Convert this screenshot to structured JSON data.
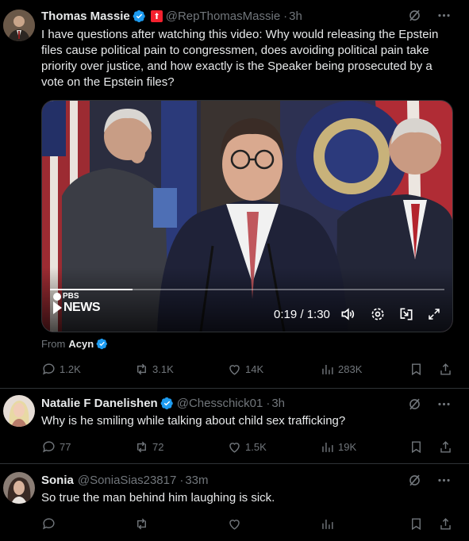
{
  "posts": [
    {
      "name": "Thomas Massie",
      "handle": "@RepThomasMassie",
      "time": "3h",
      "text": "I have questions after watching this video: Why would releasing the Epstein files cause political pain to congressmen, does avoiding political pain take priority over justice, and how exactly is the Speaker being prosecuted by a vote on the Epstein files?",
      "video": {
        "brand_top": "PBS",
        "brand_bottom": "NEWS",
        "time_display": "0:19 / 1:30",
        "progress": 0.21
      },
      "from_label": "From",
      "from_name": "Acyn",
      "replies": "1.2K",
      "reposts": "3.1K",
      "likes": "14K",
      "views": "283K"
    },
    {
      "name": "Natalie F Danelishen",
      "handle": "@Chesschick01",
      "time": "3h",
      "text": "Why is he smiling while talking about child sex trafficking?",
      "replies": "77",
      "reposts": "72",
      "likes": "1.5K",
      "views": "19K"
    },
    {
      "name": "Sonia",
      "handle": "@SoniaSias23817",
      "time": "33m",
      "text": "So true the man behind him laughing is sick."
    }
  ],
  "colors": {
    "background": "#000000",
    "text": "#e7e9ea",
    "muted": "#71767b",
    "verified": "#1d9bf0",
    "gov_badge": "#f4212e"
  },
  "icons": [
    "grok-icon",
    "more-icon",
    "reply-icon",
    "repost-icon",
    "like-icon",
    "views-icon",
    "bookmark-icon",
    "share-icon",
    "verified-badge-icon",
    "volume-icon",
    "settings-icon",
    "minimize-icon",
    "fullscreen-icon"
  ]
}
